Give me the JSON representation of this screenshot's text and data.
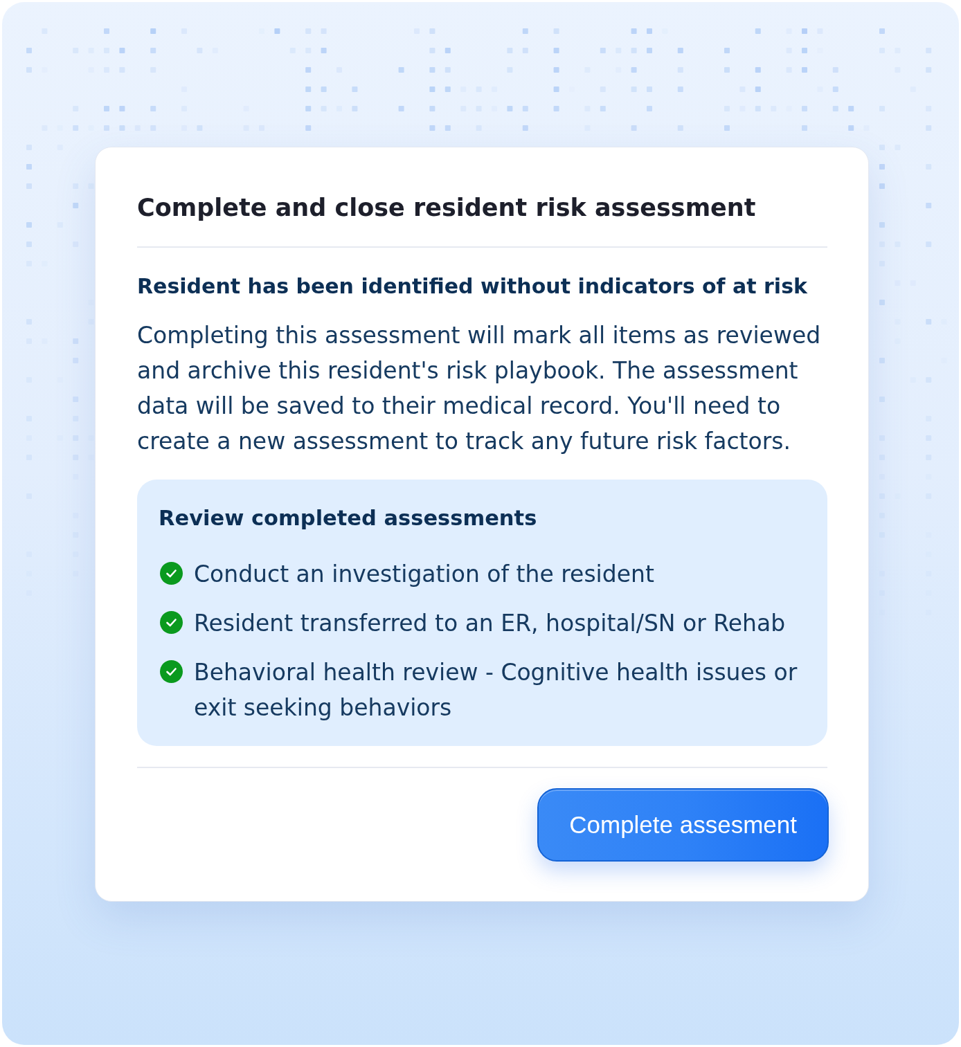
{
  "dialog": {
    "title": "Complete and close resident risk assessment",
    "status_heading": "Resident has been identified without indicators of at risk",
    "description": "Completing this assessment will mark all items as reviewed and archive this resident's risk playbook. The assessment data will be saved to their medical record. You'll need to create a new assessment to track any future risk factors.",
    "review": {
      "title": "Review completed assessments",
      "items": [
        {
          "label": "Conduct an investigation of the resident",
          "checked": true
        },
        {
          "label": "Resident transferred to an ER, hospital/SN or Rehab",
          "checked": true
        },
        {
          "label": "Behavioral health review - Cognitive health issues or exit seeking behaviors",
          "checked": true
        }
      ]
    },
    "primary_button": {
      "label": "Complete assesment"
    }
  }
}
